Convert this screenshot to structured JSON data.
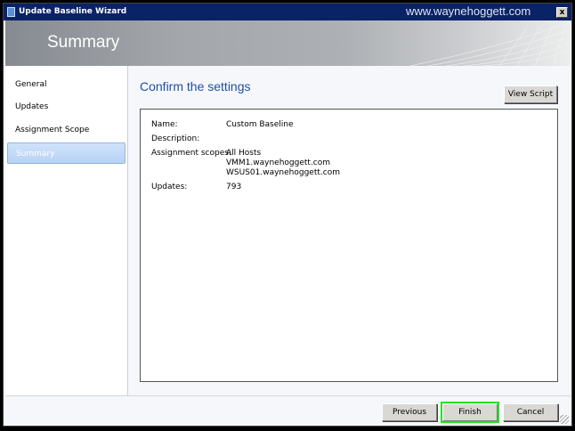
{
  "window": {
    "title": "Update Baseline Wizard",
    "watermark": "www.waynehoggett.com",
    "close_label": "x"
  },
  "banner": {
    "title": "Summary"
  },
  "nav": {
    "items": [
      {
        "label": "General"
      },
      {
        "label": "Updates"
      },
      {
        "label": "Assignment Scope"
      },
      {
        "label": "Summary",
        "active": true
      }
    ]
  },
  "main": {
    "heading": "Confirm the settings",
    "view_script": "View Script",
    "settings": {
      "name_label": "Name:",
      "name_value": "Custom Baseline",
      "description_label": "Description:",
      "scopes_label": "Assignment scopes:",
      "scopes": [
        "All Hosts",
        "VMM1.waynehoggett.com",
        "WSUS01.waynehoggett.com"
      ],
      "updates_label": "Updates:",
      "updates_value": "793"
    }
  },
  "footer": {
    "previous": "Previous",
    "finish": "Finish",
    "cancel": "Cancel"
  }
}
